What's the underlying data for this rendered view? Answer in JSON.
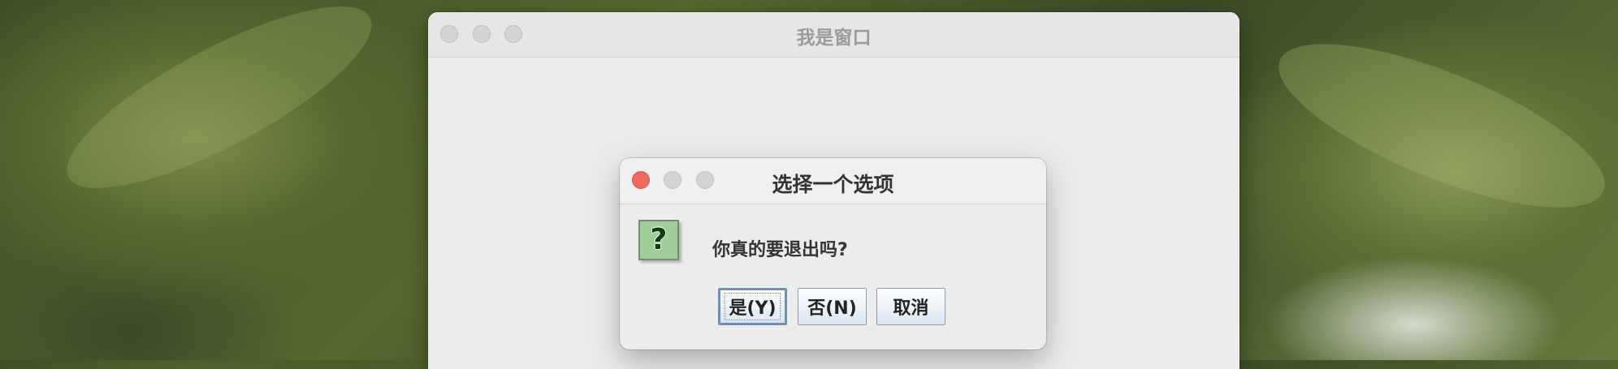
{
  "main_window": {
    "title": "我是窗口"
  },
  "dialog": {
    "title": "选择一个选项",
    "icon": "question-icon",
    "message": "你真的要退出吗?",
    "buttons": {
      "yes": "是(Y)",
      "no": "否(N)",
      "cancel": "取消"
    }
  },
  "colors": {
    "close_button": "#ee6a5f",
    "icon_background": "#9fce98",
    "button_gradient_end": "#dbe6f3"
  }
}
